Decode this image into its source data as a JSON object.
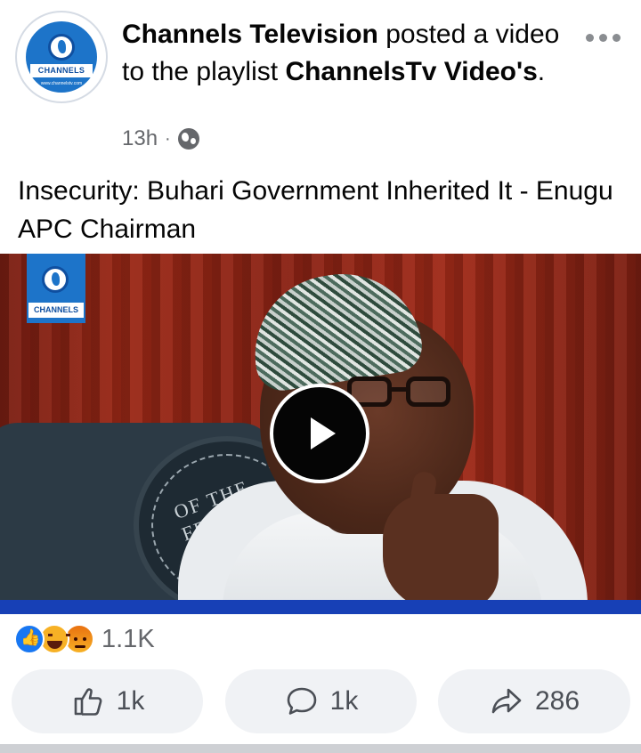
{
  "post": {
    "author": "Channels Television",
    "action_text": " posted a video to the playlist ",
    "playlist": "ChannelsTv Video's",
    "suffix": ".",
    "time": "13h",
    "separator": "·",
    "caption": "Insecurity: Buhari Government Inherited It - Enugu APC Chairman"
  },
  "avatar": {
    "brand": "CHANNELS",
    "url": "www.channelstv.com"
  },
  "video": {
    "logo_label": "CHANNELS",
    "seal_text": "OF THE FEDERAL"
  },
  "reactions": {
    "types": [
      "like",
      "haha",
      "angry"
    ],
    "count": "1.1K"
  },
  "actions": {
    "like_count": "1k",
    "comment_count": "1k",
    "share_count": "286"
  },
  "colors": {
    "brand_blue": "#1d74c9",
    "progress": "#1740b6",
    "like_blue": "#1877f2"
  }
}
